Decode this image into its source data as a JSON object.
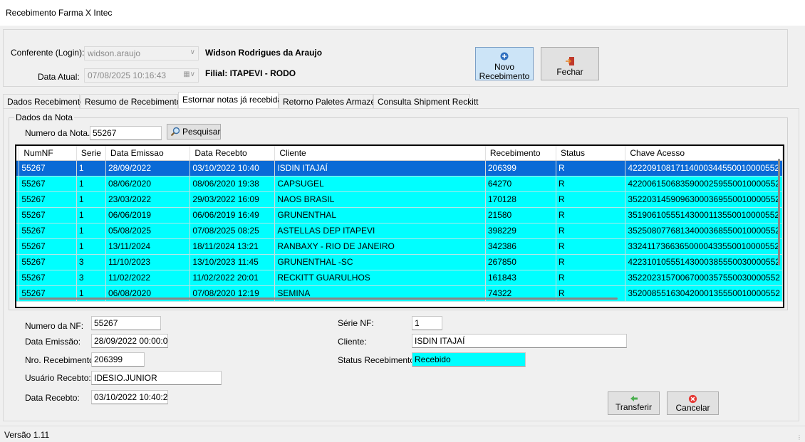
{
  "window": {
    "title": "Recebimento Farma X Intec"
  },
  "header": {
    "conferente_label": "Conferente (Login):",
    "conferente_value": "widson.araujo",
    "conferente_name": "Widson Rodrigues da Araujo",
    "data_label": "Data Atual:",
    "data_value": "07/08/2025 10:16:43",
    "filial": "Filial:  ITAPEVI - RODO",
    "novo_recebimento": "Novo\nRecebimento",
    "fechar": "Fechar"
  },
  "tabs": [
    "Dados Recebimento",
    "Resumo de Recebimentos",
    "Estornar notas já recebidas",
    "Retorno Paletes Armazém",
    "Consulta Shipment Reckitt"
  ],
  "dados_nota": {
    "group_label": "Dados da Nota",
    "numero_label": "Numero da Nota.",
    "numero_value": "55267",
    "pesquisar": "Pesquisar"
  },
  "grid": {
    "columns": [
      "NumNF",
      "Serie",
      "Data Emissao",
      "Data Recebto",
      "Cliente",
      "Recebimento",
      "Status",
      "Chave Acesso"
    ],
    "rows": [
      [
        "55267",
        "1",
        "28/09/2022",
        "03/10/2022 10:40",
        "ISDIN ITAJAÍ",
        "206399",
        "R",
        "42220910817114000344550010000552"
      ],
      [
        "55267",
        "1",
        "08/06/2020",
        "08/06/2020 19:38",
        "CAPSUGEL",
        "64270",
        "R",
        "42200615068359000259550010000552"
      ],
      [
        "55267",
        "1",
        "23/03/2022",
        "29/03/2022 16:09",
        "NAOS BRASIL",
        "170128",
        "R",
        "35220314590963000369550010000552"
      ],
      [
        "55267",
        "1",
        "06/06/2019",
        "06/06/2019 16:49",
        "GRUNENTHAL",
        "21580",
        "R",
        "35190610555143000113550010000552"
      ],
      [
        "55267",
        "1",
        "05/08/2025",
        "07/08/2025 08:25",
        "ASTELLAS DEP ITAPEVI",
        "398229",
        "R",
        "35250807768134000368550010000552"
      ],
      [
        "55267",
        "1",
        "13/11/2024",
        "18/11/2024 13:21",
        "RANBAXY - RIO DE JANEIRO",
        "342386",
        "R",
        "33241173663650000433550010000552"
      ],
      [
        "55267",
        "3",
        "11/10/2023",
        "13/10/2023 11:45",
        "GRUNENTHAL -SC",
        "267850",
        "R",
        "42231010555143000385550030000552"
      ],
      [
        "55267",
        "3",
        "11/02/2022",
        "11/02/2022 20:01",
        "RECKITT GUARULHOS",
        "161843",
        "R",
        "35220231570067000357550030000552"
      ],
      [
        "55267",
        "1",
        "06/08/2020",
        "07/08/2020 12:19",
        "SEMINA",
        "74322",
        "R",
        "35200855163042000135550010000552"
      ]
    ]
  },
  "details": {
    "numero_nf_label": "Numero da NF:",
    "numero_nf_value": "55267",
    "data_emissao_label": "Data Emissão:",
    "data_emissao_value": "28/09/2022 00:00:00",
    "nro_receb_label": "Nro. Recebimento:",
    "nro_receb_value": "206399",
    "usuario_label": "Usuário Recebto:",
    "usuario_value": "IDESIO.JUNIOR",
    "data_recebto_label": "Data Recebto:",
    "data_recebto_value": "03/10/2022 10:40:27",
    "serie_label": "Série NF:",
    "serie_value": "1",
    "cliente_label": "Cliente:",
    "cliente_value": "ISDIN ITAJAÍ",
    "status_label": "Status Recebimento:",
    "status_value": "Recebido",
    "transferir": "Transferir",
    "cancelar": "Cancelar"
  },
  "statusbar": {
    "version": "Versão 1.11"
  },
  "colors": {
    "grid_row": "#00ffff",
    "selected_row": "#0a6ad6"
  }
}
